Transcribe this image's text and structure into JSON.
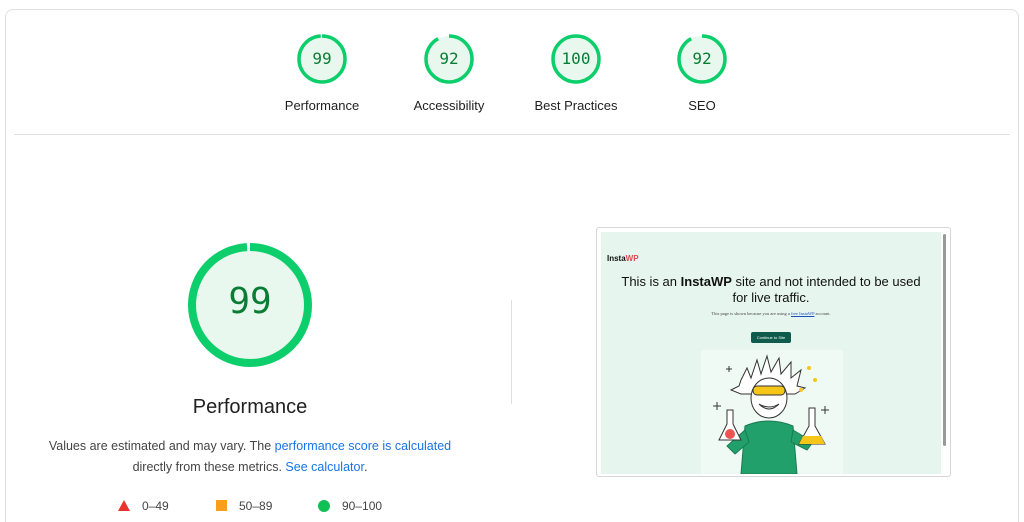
{
  "gauges": [
    {
      "score": "99",
      "label": "Performance"
    },
    {
      "score": "92",
      "label": "Accessibility"
    },
    {
      "score": "100",
      "label": "Best Practices"
    },
    {
      "score": "92",
      "label": "SEO"
    }
  ],
  "performance": {
    "score": "99",
    "title": "Performance",
    "desc_part1": "Values are estimated and may vary. The ",
    "desc_link1": "performance score is calculated",
    "desc_part2": "directly from these metrics. ",
    "desc_link2": "See calculator",
    "desc_end": "."
  },
  "legend": {
    "fail": "0–49",
    "average": "50–89",
    "pass": "90–100"
  },
  "screenshot": {
    "logo_main": "Insta",
    "logo_accent": "WP",
    "headline_part1": "This is an ",
    "headline_bold": "InstaWP",
    "headline_part2": " site and not intended to be used",
    "headline_line2": "for live traffic.",
    "note_part1": "This page is shown because you are using a ",
    "note_link": "free InstaWP",
    "note_part2": " account.",
    "cta": "Continue to Site"
  },
  "colors": {
    "pass": "#0cce6b",
    "pass_text": "#0a7d34",
    "pass_fill": "#e8f8ee",
    "link": "#1a73e8",
    "fail": "#e8342f",
    "average": "#fa9e1b"
  }
}
